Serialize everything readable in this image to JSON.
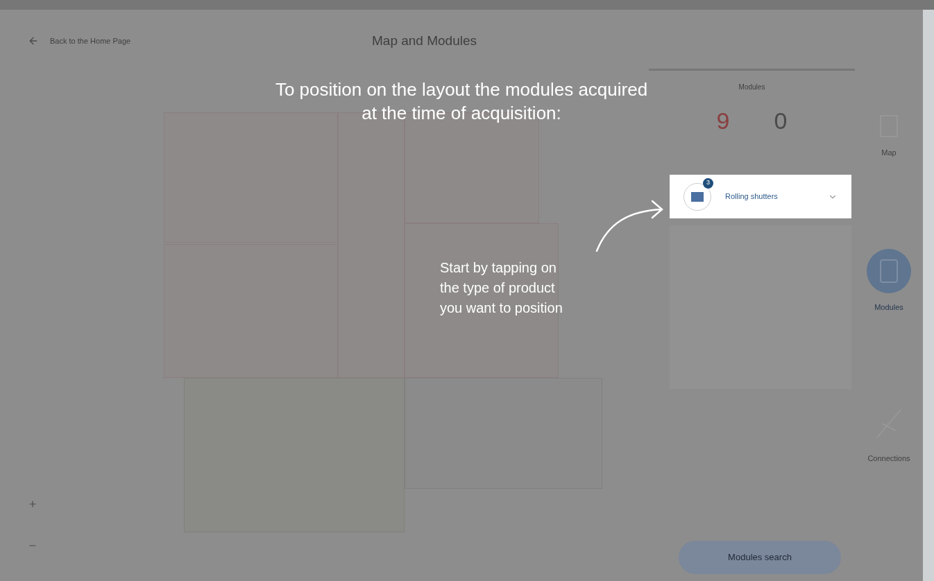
{
  "header": {
    "back_label": "Back to the Home Page",
    "title": "Map and Modules"
  },
  "panel": {
    "heading": "Modules",
    "counts": [
      {
        "value": "9",
        "kind": "alert"
      },
      {
        "value": "0",
        "kind": "plain"
      }
    ]
  },
  "product_row": {
    "label": "Rolling shutters",
    "badge": "3"
  },
  "rail": [
    {
      "label": "Map",
      "kind": "map",
      "selected": false
    },
    {
      "label": "Modules",
      "kind": "modules",
      "selected": true
    },
    {
      "label": "Connections",
      "kind": "connections",
      "selected": false
    }
  ],
  "search_button": "Modules search",
  "tutorial": {
    "title": "To position on the layout the modules acquired at the time of acquisition:",
    "hint": "Start by tapping on the type of product you want to position"
  }
}
